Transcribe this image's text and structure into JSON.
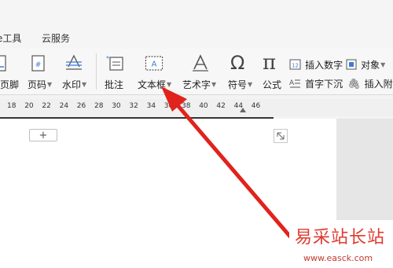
{
  "menu": {
    "item1": "e工具",
    "item2": "云服务"
  },
  "ribbon": {
    "header_footer": "页脚",
    "page_number": "页码",
    "watermark": "水印",
    "comment": "批注",
    "textbox": "文本框",
    "wordart": "艺术字",
    "symbol": "符号",
    "formula": "公式",
    "insert_number": "插入数字",
    "object": "对象",
    "drop_cap": "首字下沉",
    "insert_attachment": "插入附"
  },
  "ruler": {
    "ticks": [
      "18",
      "20",
      "22",
      "24",
      "26",
      "28",
      "30",
      "32",
      "34",
      "36",
      "38",
      "40",
      "42",
      "44",
      "46"
    ]
  },
  "document": {
    "add_button": "+"
  },
  "watermark_site": {
    "title": "易采站长站",
    "url": "www.easck.com"
  },
  "colors": {
    "annotation_arrow": "#e0231c"
  }
}
